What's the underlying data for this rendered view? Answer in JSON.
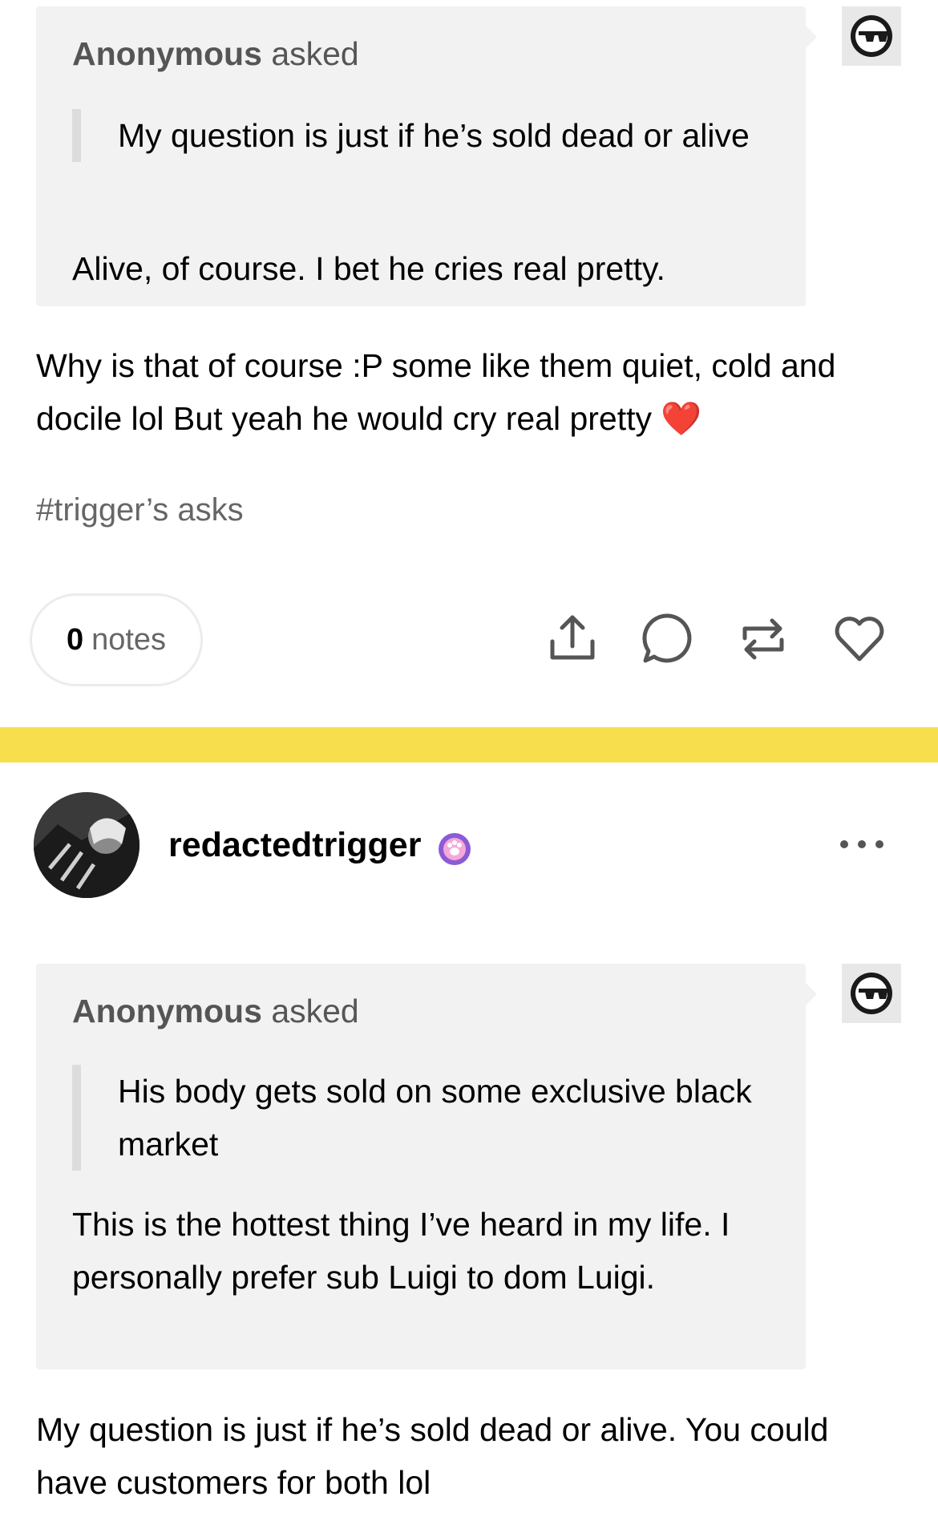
{
  "post1": {
    "ask": {
      "asker_name": "Anonymous",
      "asker_verb": "asked",
      "quote": "My question is just if he’s sold dead or alive",
      "answer": "Alive, of course. I bet he cries real pretty."
    },
    "body": "Why is that of course :P some like them quiet, cold and docile lol But yeah he would cry real pretty",
    "emoji": "❤️",
    "tag": "#trigger’s asks",
    "notes_count": "0",
    "notes_label": "notes",
    "actions": [
      "share-icon",
      "reply-icon",
      "reblog-icon",
      "like-icon"
    ]
  },
  "divider_color": "#f7de4d",
  "post2": {
    "username": "redactedtrigger",
    "badge": "paw-badge-icon",
    "ask": {
      "asker_name": "Anonymous",
      "asker_verb": "asked",
      "quote": "His body gets sold on some exclusive black market",
      "answer": "This is the hottest thing I’ve heard in my life. I personally prefer sub Luigi to dom Luigi."
    },
    "body": "My question is just if he’s sold dead or alive. You could have customers for both lol"
  }
}
